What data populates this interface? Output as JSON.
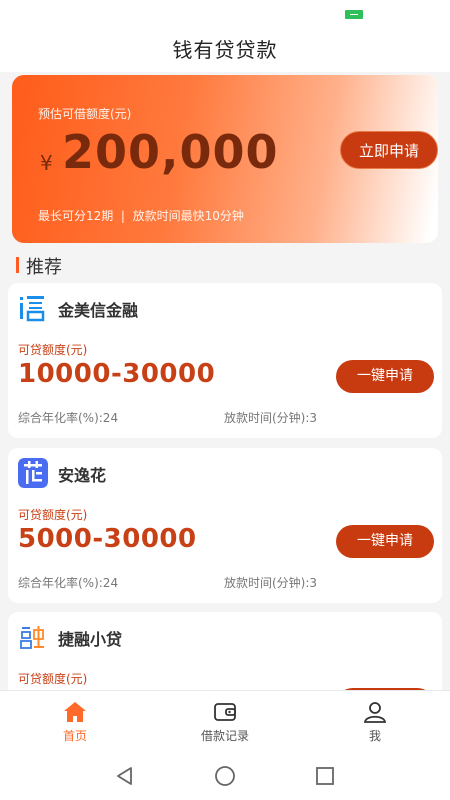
{
  "app": {
    "title": "钱有贷贷款"
  },
  "hero": {
    "label": "预估可借额度(元)",
    "currency": "¥",
    "amount": "200,000",
    "footer": "最长可分12期  |  放款时间最快10分钟",
    "apply_label": "立即申请"
  },
  "section": {
    "title": "推荐"
  },
  "cards": [
    {
      "name": "金美信金融",
      "icon": "xin-logo-icon",
      "amount_label": "可贷额度(元)",
      "amount": "10000-30000",
      "rate": "综合年化率(%):24",
      "time": "放款时间(分钟):3",
      "apply_label": "一键申请"
    },
    {
      "name": "安逸花",
      "icon": "hua-logo-icon",
      "amount_label": "可贷额度(元)",
      "amount": "5000-30000",
      "rate": "综合年化率(%):24",
      "time": "放款时间(分钟):3",
      "apply_label": "一键申请"
    },
    {
      "name": "捷融小贷",
      "icon": "rong-logo-icon",
      "amount_label": "可贷额度(元)"
    }
  ],
  "tabbar": {
    "items": [
      {
        "label": "首页",
        "icon": "home-icon",
        "active": true
      },
      {
        "label": "借款记录",
        "icon": "wallet-icon",
        "active": false
      },
      {
        "label": "我",
        "icon": "user-icon",
        "active": false
      }
    ]
  },
  "colors": {
    "accent": "#ff6a2a",
    "button": "#c83a10",
    "amount": "#c84016"
  }
}
